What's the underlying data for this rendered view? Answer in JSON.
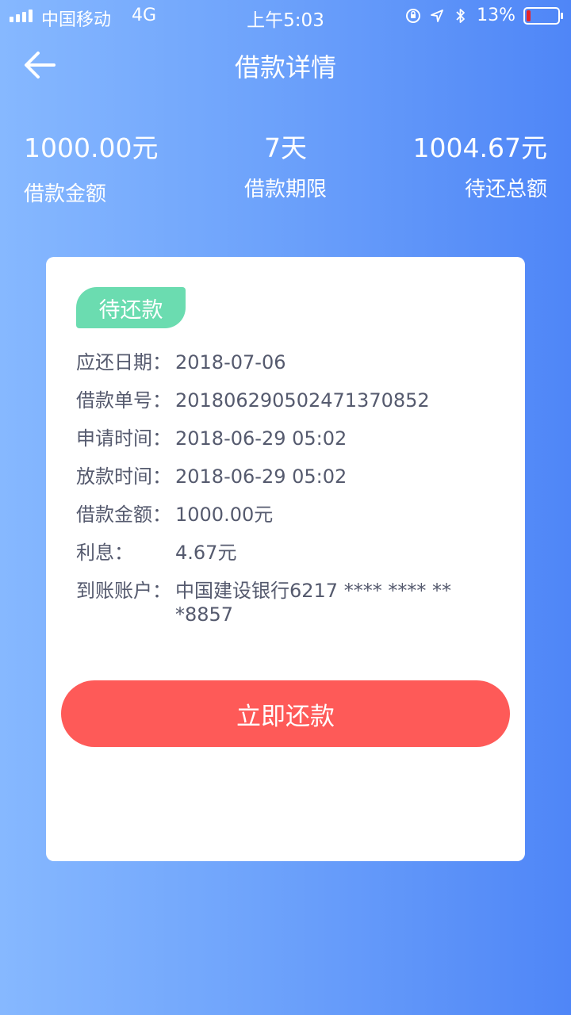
{
  "status_bar": {
    "carrier": "中国移动",
    "network": "4G",
    "time": "上午5:03",
    "battery_percent": "13%",
    "battery_level": 0.13,
    "icons": [
      "orientation-lock-icon",
      "location-arrow-icon",
      "bluetooth-icon",
      "battery-icon"
    ]
  },
  "nav": {
    "title": "借款详情",
    "back_icon": "back-arrow-icon"
  },
  "summary": {
    "amount_value": "1000.00元",
    "amount_label": "借款金额",
    "term_value": "7天",
    "term_label": "借款期限",
    "total_value": "1004.67元",
    "total_label": "待还总额"
  },
  "card": {
    "status_badge": "待还款",
    "rows": [
      {
        "label": "应还日期：",
        "value": "2018-07-06"
      },
      {
        "label": "借款单号：",
        "value": "20180629050247137085​2"
      },
      {
        "label": "申请时间：",
        "value": "2018-06-29 05:02"
      },
      {
        "label": "放款时间：",
        "value": "2018-06-29 05:02"
      },
      {
        "label": "借款金额：",
        "value": "1000.00元"
      },
      {
        "label": "利息：",
        "value": "4.67元"
      },
      {
        "label": "到账账户：",
        "value": "中国建设银行6217 **** **** ***8857"
      }
    ],
    "repay_button": "立即还款"
  },
  "colors": {
    "background_start": "#86b8ff",
    "background_end": "#4f86f7",
    "badge": "#6bdcb0",
    "button": "#fe5a58",
    "battery_low": "#e8242b"
  }
}
